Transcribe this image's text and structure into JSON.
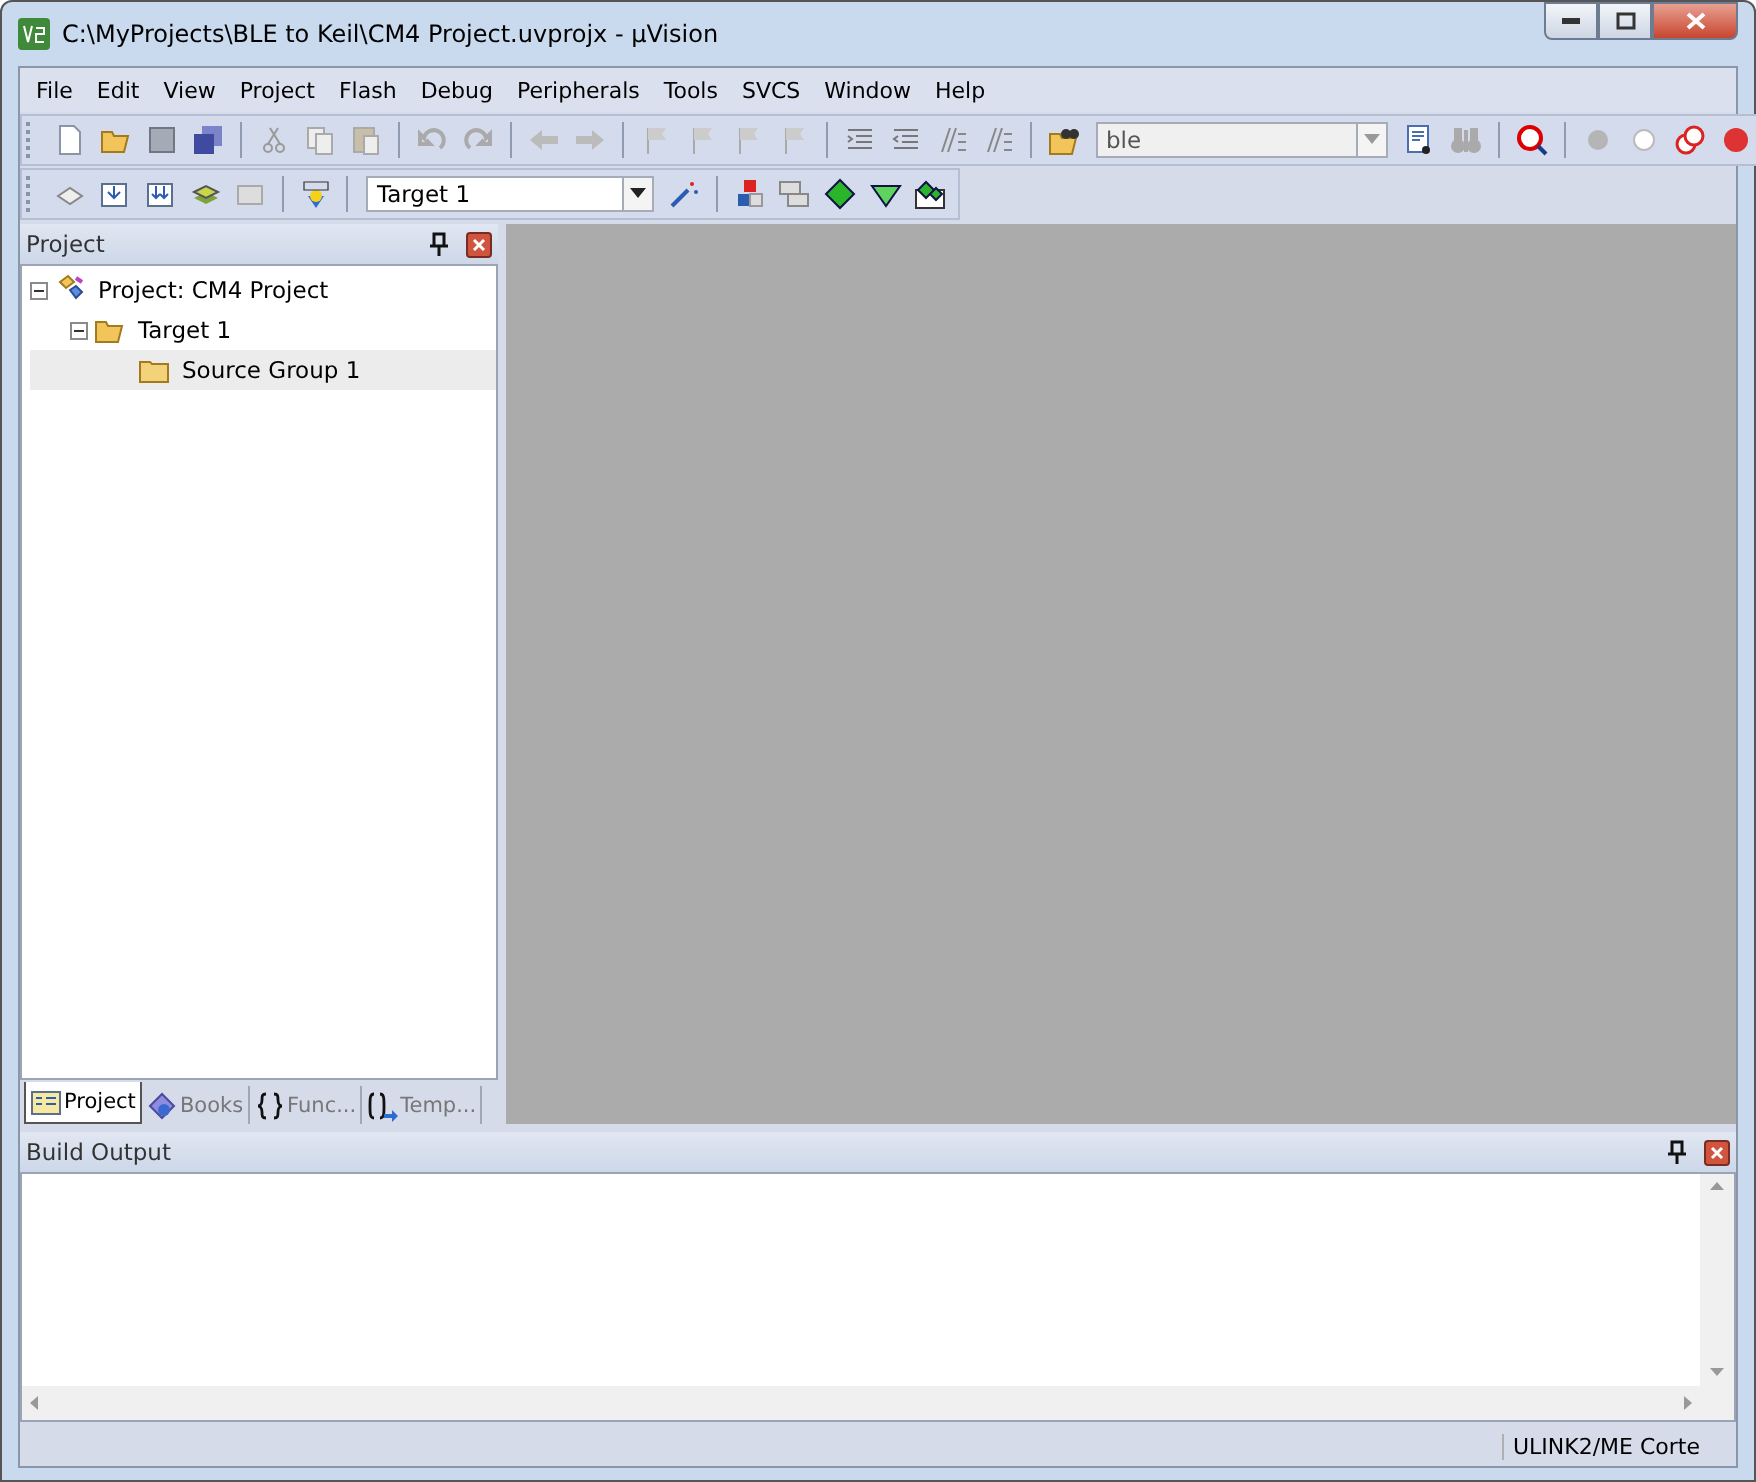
{
  "window": {
    "title": "C:\\MyProjects\\BLE to Keil\\CM4 Project.uvprojx - µVision"
  },
  "menu": [
    "File",
    "Edit",
    "View",
    "Project",
    "Flash",
    "Debug",
    "Peripherals",
    "Tools",
    "SVCS",
    "Window",
    "Help"
  ],
  "toolbar": {
    "find_field": {
      "value": "ble"
    },
    "target_select": {
      "value": "Target 1"
    }
  },
  "project_panel": {
    "title": "Project",
    "tree": [
      {
        "label": "Project: CM4 Project",
        "selected": false,
        "expanded": true,
        "children": [
          {
            "label": "Target 1",
            "selected": false,
            "expanded": true,
            "children": [
              {
                "label": "Source Group 1",
                "selected": true
              }
            ]
          }
        ]
      }
    ],
    "tabs": [
      {
        "label": "Project",
        "selected": true
      },
      {
        "label": "Books",
        "selected": false
      },
      {
        "label": "Func...",
        "selected": false
      },
      {
        "label": "Temp...",
        "selected": false
      }
    ]
  },
  "build_output": {
    "title": "Build Output"
  },
  "status_bar": {
    "target": "ULINK2/ME Corte"
  }
}
